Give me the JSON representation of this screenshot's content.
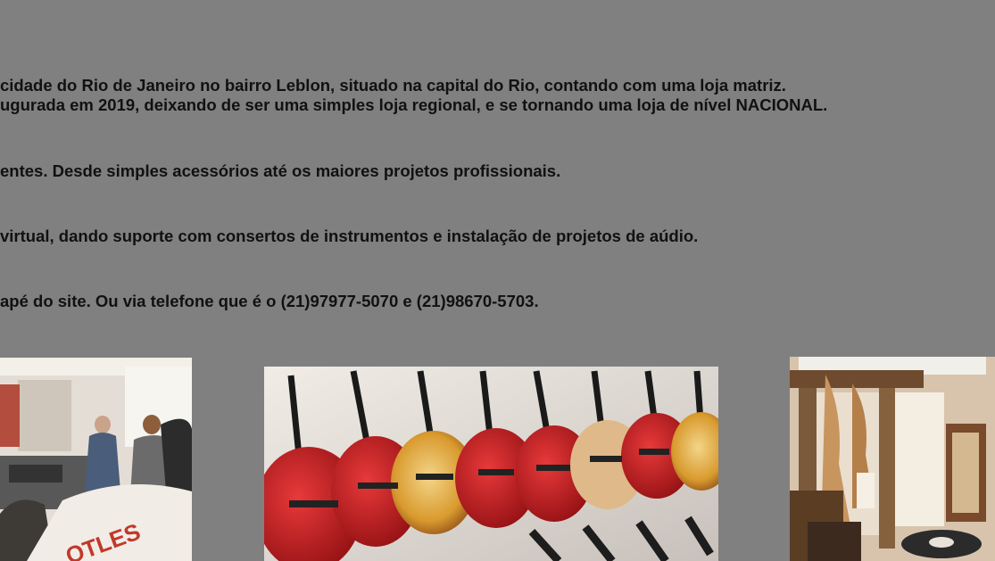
{
  "about": {
    "p1_line1": "cidade do Rio de Janeiro no bairro Leblon, situado na capital do Rio, contando com uma loja matriz.",
    "p1_line2": "ugurada em 2019, deixando de ser uma simples loja regional, e se tornando uma loja de nível NACIONAL.",
    "p2": "entes. Desde simples acessórios até os maiores projetos profissionais.",
    "p3": " virtual, dando suporte com consertos de instrumentos e instalação de projetos de aúdio.",
    "p4": "apé do site. Ou via telefone que é o (21)97977-5070 e (21)98670-5703."
  },
  "gallery": {
    "photo_store_interior_sign": "OTLES"
  },
  "colors": {
    "background": "#808080",
    "text": "#111111",
    "guitar_red": "#c0171c",
    "guitar_sunburst": "#d99a2e"
  }
}
